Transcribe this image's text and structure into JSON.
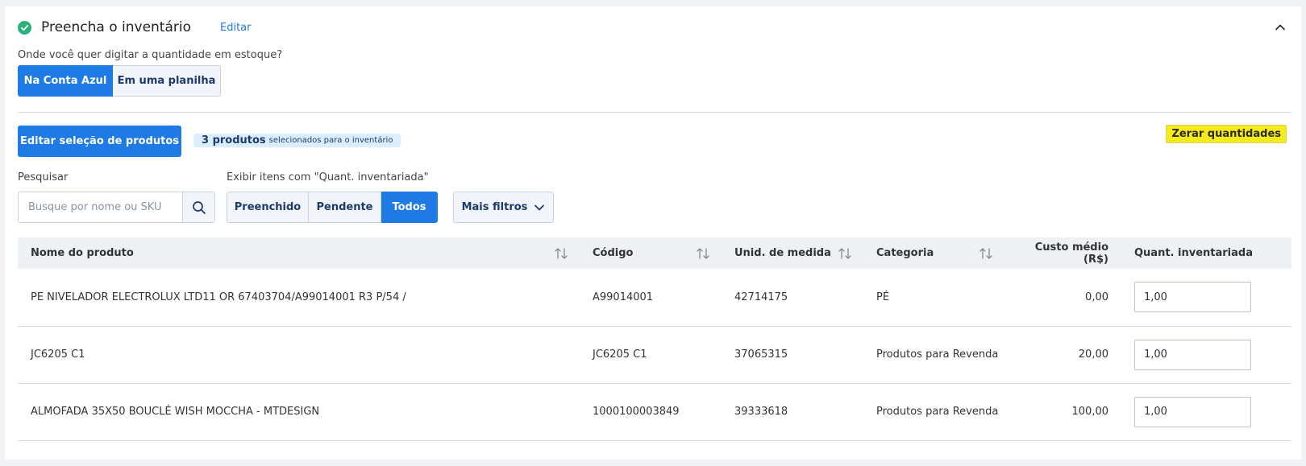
{
  "header": {
    "title": "Preencha o inventário",
    "edit_label": "Editar"
  },
  "question": "Onde você quer digitar a quantidade em estoque?",
  "input_mode": {
    "options": [
      "Na Conta Azul",
      "Em uma planilha"
    ],
    "selected": "Na Conta Azul"
  },
  "edit_selection_label": "Editar seleção de produtos",
  "selection_badge": {
    "count": "3 produtos",
    "text": "selecionados para o inventário"
  },
  "zerar_label": "Zerar quantidades",
  "search": {
    "label": "Pesquisar",
    "placeholder": "Busque por nome ou SKU"
  },
  "filter": {
    "label": "Exibir itens com \"Quant. inventariada\"",
    "options": [
      "Preenchido",
      "Pendente",
      "Todos"
    ],
    "selected": "Todos"
  },
  "more_filters_label": "Mais filtros",
  "table": {
    "headers": [
      "Nome do produto",
      "Código",
      "Unid. de medida",
      "Categoria",
      "Custo médio (R$)",
      "Quant. inventariada"
    ],
    "rows": [
      {
        "nome": "PE NIVELADOR ELECTROLUX LTD11 OR 67403704/A99014001 R3 P/54 /",
        "codigo": "A99014001",
        "unid": "42714175",
        "categoria": "PÉ",
        "custo": "0,00",
        "quant": "1,00"
      },
      {
        "nome": "JC6205 C1",
        "codigo": "JC6205 C1",
        "unid": "37065315",
        "categoria": "Produtos para Revenda",
        "custo": "20,00",
        "quant": "1,00"
      },
      {
        "nome": "ALMOFADA 35X50 BOUCLÉ WISH MOCCHA - MTDESIGN",
        "codigo": "1000100003849",
        "unid": "39333618",
        "categoria": "Produtos para Revenda",
        "custo": "100,00",
        "quant": "1,00"
      }
    ]
  },
  "colors": {
    "primary": "#1e7be6",
    "success": "#2ab27b",
    "highlight": "#f5eb1c"
  }
}
